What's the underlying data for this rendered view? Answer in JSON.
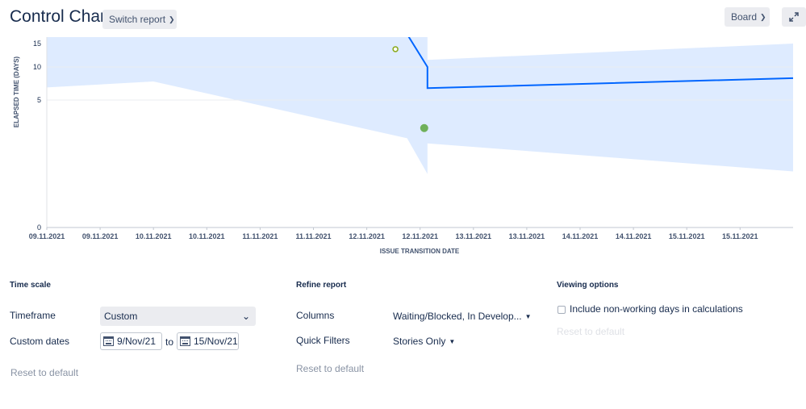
{
  "header": {
    "title": "Control Chart",
    "switch_report_label": "Switch report",
    "board_label": "Board",
    "expand_icon": "expand-icon"
  },
  "chart_data": {
    "type": "line",
    "ylabel": "ELAPSED TIME (DAYS)",
    "xlabel": "ISSUE TRANSITION DATE",
    "y_ticks": [
      "15",
      "10",
      "5",
      "0"
    ],
    "x_ticks": [
      "09.11.2021",
      "09.11.2021",
      "10.11.2021",
      "10.11.2021",
      "11.11.2021",
      "11.11.2021",
      "12.11.2021",
      "12.11.2021",
      "13.11.2021",
      "13.11.2021",
      "14.11.2021",
      "14.11.2021",
      "15.11.2021",
      "15.11.2021"
    ],
    "series": [
      {
        "kind": "rolling_average",
        "color": "#0065ff",
        "points": [
          [
            12.38,
            17
          ],
          [
            12.57,
            10
          ],
          [
            12.57,
            6.8
          ],
          [
            16.0,
            8.3
          ]
        ]
      }
    ],
    "band": {
      "color": "#deebff",
      "upper": [
        [
          9.0,
          17
        ],
        [
          12.57,
          17
        ],
        [
          12.57,
          11.5
        ],
        [
          16.0,
          15.0
        ]
      ],
      "lower": [
        [
          9.0,
          6.9
        ],
        [
          10.0,
          7.8
        ],
        [
          12.38,
          3.5
        ],
        [
          12.57,
          2.1
        ],
        [
          12.57,
          3.3
        ],
        [
          16.0,
          2.2
        ]
      ]
    },
    "points": [
      {
        "x": 12.54,
        "y": 3.9,
        "style": "filled",
        "color": "#6fb05a"
      },
      {
        "x": 12.27,
        "y": 13.8,
        "style": "hollow",
        "color": "#8aa91a"
      }
    ]
  },
  "time_scale": {
    "title": "Time scale",
    "timeframe_label": "Timeframe",
    "timeframe_value": "Custom",
    "custom_dates_label": "Custom dates",
    "from_date": "9/Nov/21",
    "to_word": "to",
    "to_date": "15/Nov/21",
    "reset_label": "Reset to default"
  },
  "refine": {
    "title": "Refine report",
    "columns_label": "Columns",
    "columns_value": "Waiting/Blocked, In Develop...",
    "quick_filters_label": "Quick Filters",
    "quick_filters_value": "Stories Only",
    "reset_label": "Reset to default"
  },
  "viewing": {
    "title": "Viewing options",
    "checkbox_label": "Include non-working days in calculations",
    "checkbox_checked": false,
    "reset_label": "Reset to default"
  }
}
